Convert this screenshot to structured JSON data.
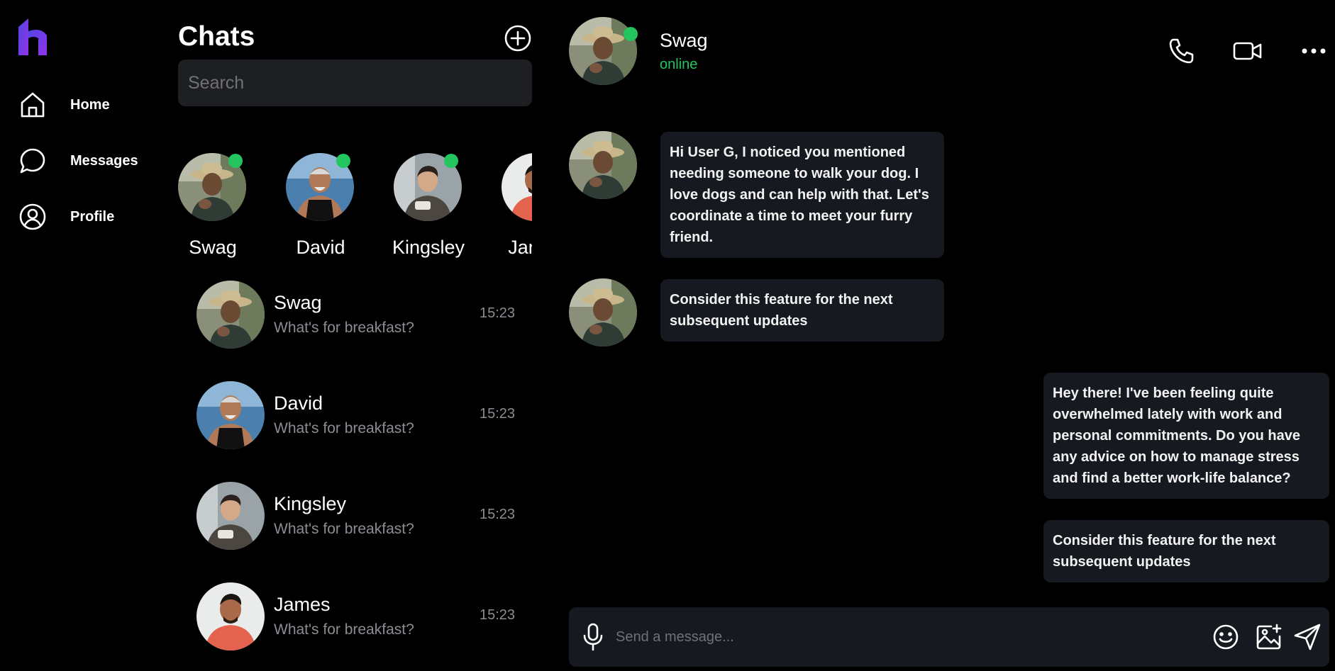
{
  "nav": {
    "logo": "brand-logo-icon",
    "items": [
      {
        "label": "Home",
        "icon": "home-icon"
      },
      {
        "label": "Messages",
        "icon": "chat-bubble-icon"
      },
      {
        "label": "Profile",
        "icon": "user-circle-icon"
      }
    ]
  },
  "chats": {
    "title": "Chats",
    "add_icon": "plus-circle-icon",
    "search_placeholder": "Search",
    "stories": [
      {
        "name": "Swag",
        "online": true
      },
      {
        "name": "David",
        "online": true
      },
      {
        "name": "Kingsley",
        "online": true
      },
      {
        "name": "James",
        "online": false
      }
    ],
    "list": [
      {
        "name": "Swag",
        "preview": "What's for breakfast?",
        "time": "15:23"
      },
      {
        "name": "David",
        "preview": "What's for breakfast?",
        "time": "15:23"
      },
      {
        "name": "Kingsley",
        "preview": "What's for breakfast?",
        "time": "15:23"
      },
      {
        "name": "James",
        "preview": "What's for breakfast?",
        "time": "15:23"
      }
    ]
  },
  "conversation": {
    "contact_name": "Swag",
    "status": "online",
    "actions": [
      "phone-icon",
      "video-icon",
      "more-icon"
    ],
    "messages": [
      {
        "from": "contact",
        "text": "Hi User G, I noticed you mentioned needing someone to walk your dog. I love dogs and can help with that. Let's coordinate a time to meet your furry friend."
      },
      {
        "from": "contact",
        "text": "Consider this feature for the next subsequent updates"
      },
      {
        "from": "me",
        "text": "Hey there! I've been feeling quite overwhelmed lately with work and personal commitments. Do you have any advice on how to manage stress and find a better work-life balance?"
      },
      {
        "from": "me",
        "text": "Consider this feature for the next subsequent updates"
      }
    ],
    "composer_placeholder": "Send a message..."
  },
  "colors": {
    "background": "#000000",
    "surface": "#1e1f22",
    "bubble": "#161a20",
    "online": "#22c55e",
    "logo": "#7c3aed"
  }
}
